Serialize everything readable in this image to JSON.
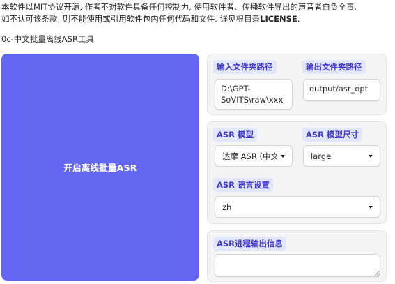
{
  "notice": {
    "line1": "本软件以MIT协议开源, 作者不对软件具备任何控制力, 使用软件者、传播软件导出的声音者自负全责.",
    "line2_prefix": "如不认可该条款, 则不能使用或引用软件包内任何代码和文件. 详见根目录",
    "line2_bold": "LICENSE",
    "line2_suffix": "."
  },
  "section_title": "0c-中文批量离线ASR工具",
  "start_button": "开启离线批量ASR",
  "input_dir": {
    "label": "输入文件夹路径",
    "value": "D:\\GPT-SoVITS\\raw\\xxx"
  },
  "output_dir": {
    "label": "输出文件夹路径",
    "value": "output/asr_opt"
  },
  "asr_model": {
    "label": "ASR 模型",
    "value": "达摩 ASR (中文)"
  },
  "asr_size": {
    "label": "ASR 模型尺寸",
    "value": "large"
  },
  "asr_lang": {
    "label": "ASR 语言设置",
    "value": "zh"
  },
  "asr_output": {
    "label": "ASR进程输出信息",
    "value": ""
  },
  "colors": {
    "accent": "#6366f1",
    "chip_bg": "#e0e7ff",
    "chip_text": "#4338ca",
    "panel_bg": "#f4f4f5"
  }
}
